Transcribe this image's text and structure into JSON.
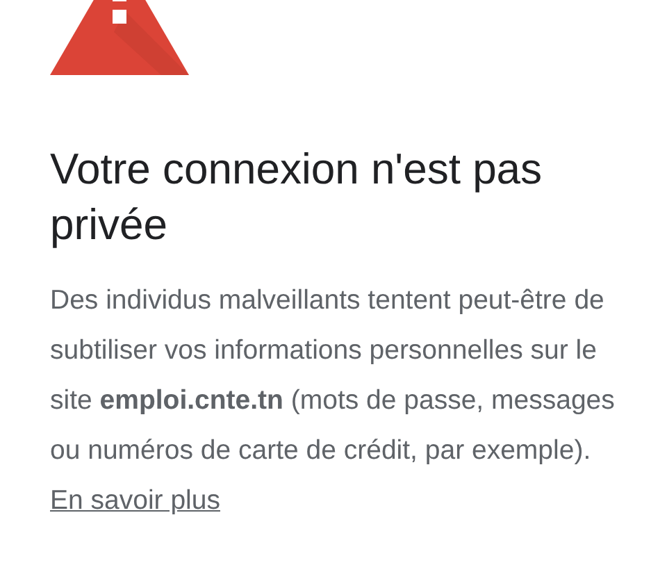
{
  "heading": "Votre connexion n'est pas privée",
  "message": "Des individus malveillants tentent peut-être de subtiliser vos informations personnelles sur le site **emploi.cnte.tn** (mots de passe, messages ou numéros de carte de crédit, par exemple).",
  "learn_more_link": "En savoir plus"
}
